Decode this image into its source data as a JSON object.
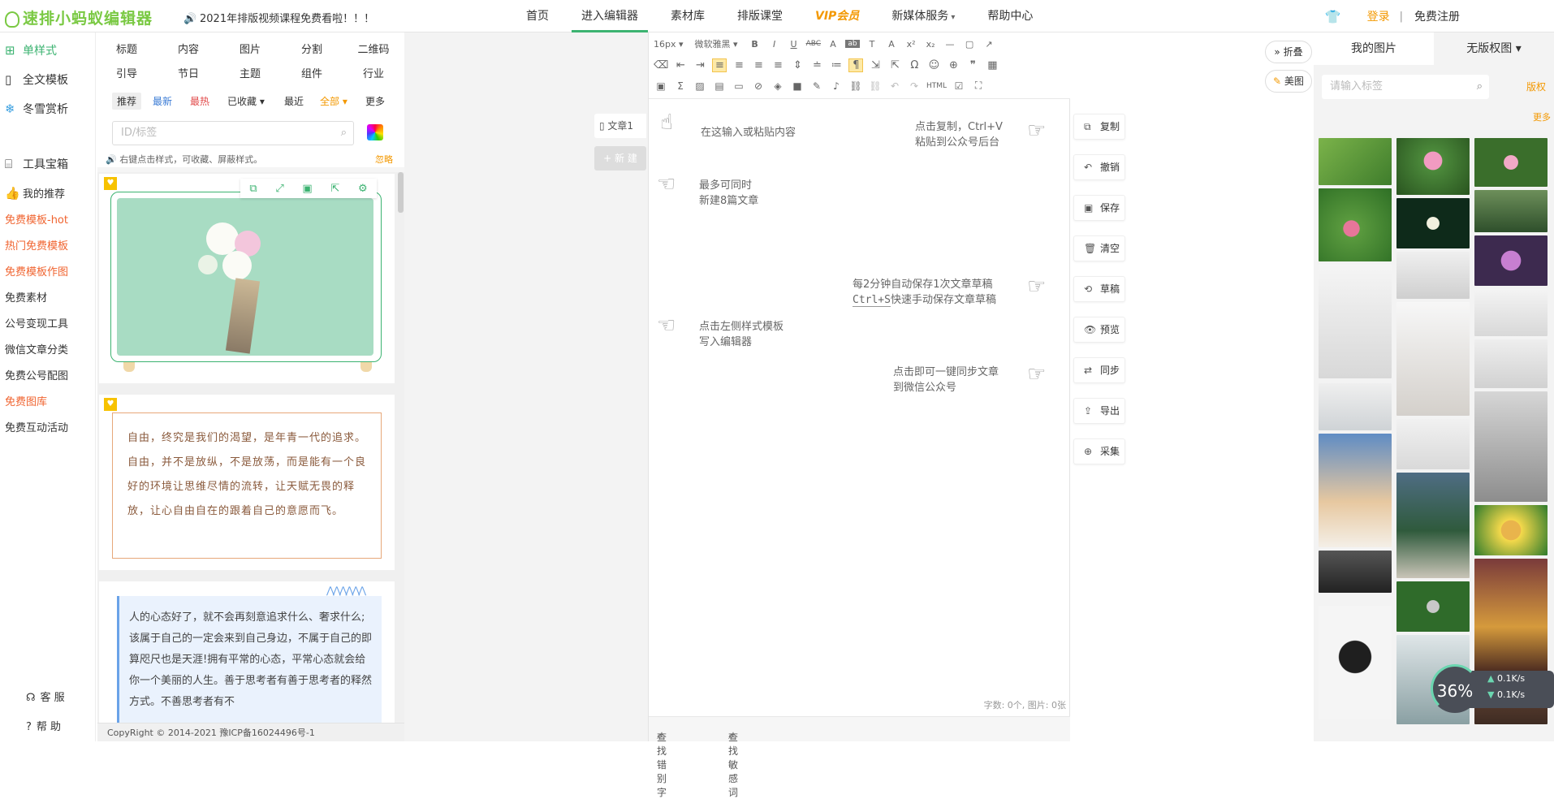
{
  "app": {
    "logo_text": "速排小蚂蚁编辑器",
    "announcement": "2021年排版视频课程免费看啦！！！"
  },
  "nav": {
    "items": [
      {
        "label": "首页"
      },
      {
        "label": "进入编辑器"
      },
      {
        "label": "素材库"
      },
      {
        "label": "排版课堂"
      },
      {
        "label": "VIP会员"
      },
      {
        "label": "新媒体服务"
      },
      {
        "label": "帮助中心"
      }
    ],
    "login": "登录",
    "separator": "|",
    "register": "免费注册"
  },
  "left_sidebar": {
    "main": [
      {
        "label": "单样式",
        "icon": "grid-icon"
      },
      {
        "label": "全文模板",
        "icon": "document-icon"
      },
      {
        "label": "冬雪赏析",
        "icon": "snowflake-icon"
      },
      {
        "label": "工具宝箱",
        "icon": "toolbox-icon"
      },
      {
        "label": "我的推荐",
        "icon": "thumbs-up-icon"
      }
    ],
    "links": [
      "免费模板-hot",
      "热门免费模板",
      "免费模板作图",
      "免费素材",
      "公号变现工具",
      "微信文章分类",
      "免费公号配图",
      "免费图库",
      "免费互动活动"
    ],
    "service": "客 服",
    "help": "帮 助"
  },
  "style_panel": {
    "categories_row1": [
      "标题",
      "内容",
      "图片",
      "分割",
      "二维码"
    ],
    "categories_row2": [
      "引导",
      "节日",
      "主题",
      "组件",
      "行业"
    ],
    "filters": [
      "推荐",
      "最新",
      "最热",
      "已收藏",
      "最近",
      "全部",
      "更多"
    ],
    "search_placeholder": "ID/标签",
    "tip": "右键点击样式，可收藏、屏蔽样式。",
    "tip_ignore": "忽略",
    "card2_text": "自由，终究是我们的渴望，是年青一代的追求。自由，并不是放纵，不是放荡，而是能有一个良好的环境让思维尽情的流转，让天赋无畏的释放，让心自由自在的跟着自己的意愿而飞。",
    "card3_text": "人的心态好了，就不会再刻意追求什么、奢求什么;该属于自己的一定会来到自己身边，不属于自己的即算咫尺也是天涯!拥有平常的心态，平常心态就会给你一个美丽的人生。善于思考者有善于思考者的释然方式。不善思考者有不",
    "copyright": "CopyRight © 2014-2021 豫ICP备16024496号-1"
  },
  "doc": {
    "tab": "文章1",
    "new_button": "+ 新 建"
  },
  "toolbar": {
    "font_size": "16px",
    "font_family": "微软雅黑",
    "row1": [
      "B",
      "I",
      "U",
      "ABC",
      "A",
      "ab",
      "T",
      "A",
      "x²",
      "x₂",
      "—",
      "▢",
      "↗"
    ],
    "row2": [
      "⌫",
      "⇤",
      "⇥",
      "≡",
      "≡",
      "≡",
      "≡",
      "⇕",
      "≐",
      "≔",
      "¶",
      "⇲",
      "⇱",
      "Ω",
      "☺",
      "⊕",
      "❞",
      "▦"
    ],
    "row3": [
      "▣",
      "Σ",
      "▨",
      "▤",
      "▭",
      "⊘",
      "◈",
      "■",
      "✎",
      "♪",
      "⛓",
      "⛓",
      "↶",
      "↷",
      "HTML",
      "☑",
      "⛶"
    ]
  },
  "hints": {
    "paste": "在这输入或粘贴内容",
    "copy_l1": "点击复制，Ctrl+V",
    "copy_l2": "粘贴到公众号后台",
    "multi_l1": "最多可同时",
    "multi_l2": "新建8篇文章",
    "auto_l1": "每2分钟自动保存1次文章草稿",
    "auto_l2a": "Ctrl+S",
    "auto_l2b": "快速手动保存文章草稿",
    "tpl_l1": "点击左侧样式模板",
    "tpl_l2": "写入编辑器",
    "sync_l1": "点击即可一键同步文章",
    "sync_l2": "到微信公众号"
  },
  "editor_footer": {
    "count": "字数: 0个, 图片: 0张",
    "typo": "查找错别字",
    "sensitive": "查找敏感词"
  },
  "actions": [
    {
      "label": "复制",
      "icon": "copy-icon"
    },
    {
      "label": "撤销",
      "icon": "undo-icon"
    },
    {
      "label": "保存",
      "icon": "save-icon"
    },
    {
      "label": "清空",
      "icon": "trash-icon"
    },
    {
      "label": "草稿",
      "icon": "history-icon"
    },
    {
      "label": "预览",
      "icon": "eye-icon"
    },
    {
      "label": "同步",
      "icon": "sync-icon"
    },
    {
      "label": "导出",
      "icon": "export-icon"
    },
    {
      "label": "采集",
      "icon": "collect-icon"
    }
  ],
  "right_buttons": {
    "fold": "» 折叠",
    "meitu": "美图"
  },
  "image_panel": {
    "tabs": [
      "我的图片",
      "无版权图"
    ],
    "search_placeholder": "请输入标签",
    "copyright": "版权",
    "more": "更多"
  },
  "network": {
    "percent": "36%",
    "up": "0.1K/s",
    "down": "0.1K/s"
  },
  "colors": {
    "accent": "#3cb371",
    "orange": "#f39800",
    "red": "#f06430"
  }
}
